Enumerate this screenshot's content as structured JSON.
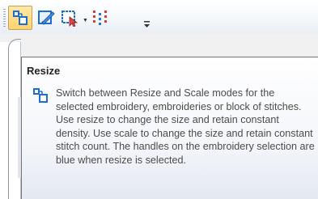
{
  "toolbar": {
    "buttons": [
      {
        "icon": "resize-mode-icon",
        "active": true
      },
      {
        "icon": "edit-stitches-icon",
        "active": false
      },
      {
        "icon": "select-region-icon",
        "active": false,
        "has_dropdown": true
      },
      {
        "icon": "color-sequence-icon",
        "active": false
      }
    ],
    "overflow_icon": "toolbar-options-icon"
  },
  "tooltip": {
    "title": "Resize",
    "icon": "resize-mode-icon",
    "description": "Switch between Resize and Scale modes for the selected embroidery, embroideries or block of stitches. Use resize to change the size and retain constant density. Use scale to change the size and retain constant stitch count. The handles on the embroidery selection are blue when resize is selected."
  },
  "colors": {
    "active_button": "#ffd36b",
    "icon_blue": "#1c6fd1",
    "tooltip_border": "#767676",
    "tooltip_text": "#4c4c4c"
  }
}
